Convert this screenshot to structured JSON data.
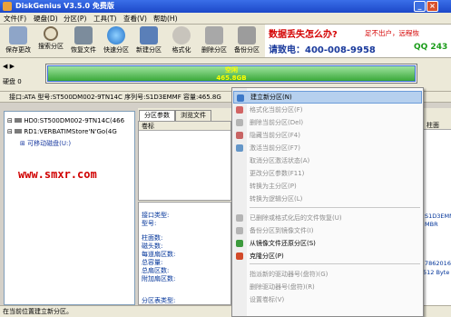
{
  "title": "DiskGenius V3.5.0 免费版",
  "menu": [
    "文件(F)",
    "硬盘(D)",
    "分区(P)",
    "工具(T)",
    "查看(V)",
    "帮助(H)"
  ],
  "toolbar": [
    "保存更改",
    "搜索分区",
    "恢复文件",
    "快速分区",
    "新建分区",
    "格式化",
    "删除分区",
    "备份分区"
  ],
  "ad": {
    "line1": "数据丢失怎么办?",
    "line1b": "足不出户，远程恢",
    "line2": "请致电：400-008-9958",
    "qq": "QQ 243"
  },
  "disk": {
    "label": "硬盘 0",
    "part_name": "空闲",
    "part_size": "465.8GB"
  },
  "infobar": "接口:ATA  型号:ST500DM002-9TN14C  序列号:S1D3EMMF  容量:465.8G",
  "tree": {
    "hd0": "HD0:ST500DM002-9TN14C(466",
    "rd1": "RD1:VERBATIMStore'N'Go(4G",
    "usb": "可移动磁盘(U:)"
  },
  "watermark": "www.smxr.com",
  "tabs": [
    "分区参数",
    "浏览文件"
  ],
  "grid_header": "卷标",
  "details_labels": [
    "接口类型:",
    "型号:",
    "柱面数:",
    "磁头数:",
    "每道扇区数:",
    "总容量:",
    "总扇区数:",
    "附加扇区数:",
    "分区表类型:"
  ],
  "side": {
    "header": "柱面",
    "val1": "S1D3EMM",
    "val2": "MBR",
    "val3": "7862016",
    "val4": "512 Byte"
  },
  "status": "在当前位置建立新分区。",
  "context_menu": [
    {
      "label": "建立新分区(N)",
      "state": "highlighted",
      "icon": "new-partition-icon",
      "color": "#3c78c8"
    },
    {
      "label": "格式化当前分区(F)",
      "state": "disabled",
      "icon": "format-icon",
      "color": "#d26464"
    },
    {
      "label": "删除当前分区(Del)",
      "state": "disabled",
      "icon": "delete-icon",
      "color": "#b4b4b4"
    },
    {
      "label": "隐藏当前分区(F4)",
      "state": "disabled",
      "icon": "hide-icon",
      "color": "#c86464"
    },
    {
      "label": "激活当前分区(F7)",
      "state": "disabled",
      "icon": "activate-icon",
      "color": "#6496c8"
    },
    {
      "label": "取消分区激活状态(A)",
      "state": "disabled",
      "icon": "",
      "color": ""
    },
    {
      "label": "更改分区参数(F11)",
      "state": "disabled",
      "icon": "",
      "color": ""
    },
    {
      "label": "转换为主分区(P)",
      "state": "disabled",
      "icon": "",
      "color": ""
    },
    {
      "label": "转换为逻辑分区(L)",
      "state": "disabled",
      "icon": "",
      "color": ""
    },
    {
      "label": "已删除或格式化后的文件恢复(U)",
      "state": "disabled",
      "icon": "recover-icon",
      "color": "#b4b4b4"
    },
    {
      "label": "备份分区到镜像文件(I)",
      "state": "disabled",
      "icon": "backup-icon",
      "color": "#b4b4b4"
    },
    {
      "label": "从镜像文件还原分区(S)",
      "state": "normal",
      "icon": "restore-icon",
      "color": "#3c9a3c"
    },
    {
      "label": "克隆分区(P)",
      "state": "normal",
      "icon": "clone-icon",
      "color": "#d24a2a"
    },
    {
      "label": "指派新的驱动器号(盘符)(G)",
      "state": "disabled",
      "icon": "",
      "color": ""
    },
    {
      "label": "删除驱动器号(盘符)(R)",
      "state": "disabled",
      "icon": "",
      "color": ""
    },
    {
      "label": "设置卷标(V)",
      "state": "disabled",
      "icon": "",
      "color": ""
    }
  ]
}
